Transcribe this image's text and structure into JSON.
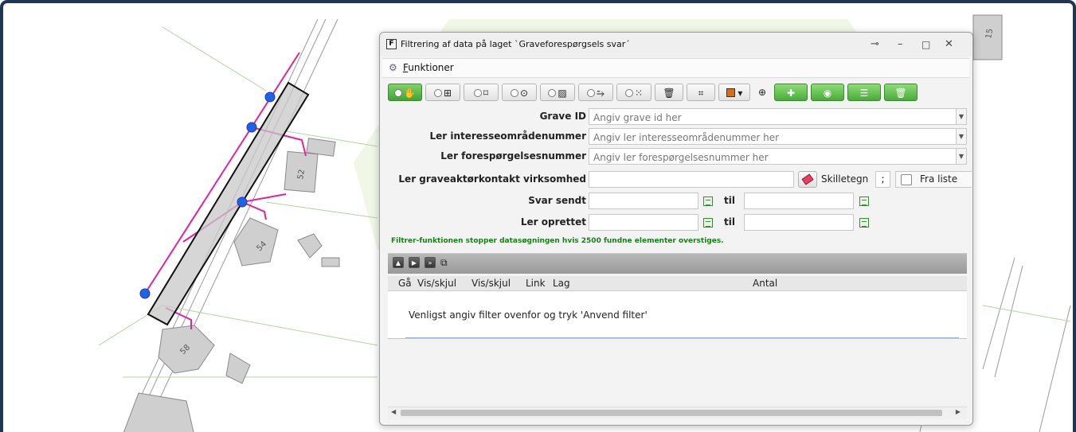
{
  "map": {
    "plot_labels": [
      "52",
      "54",
      "58",
      "15"
    ]
  },
  "dialog": {
    "title": "Filtrering af data på laget `Graveforespørgsels svar´",
    "title_icon": "F",
    "menu_label": "Funktioner",
    "menu_mnemonic": "F",
    "menu_rest": "unktioner",
    "window_buttons": {
      "pin": "⊸",
      "minimize": "–",
      "maximize": "□",
      "close": "✕"
    },
    "fields": {
      "grave_id": {
        "label": "Grave ID",
        "placeholder": "Angiv grave id her"
      },
      "interesse": {
        "label": "Ler interesseområdenummer",
        "placeholder": "Angiv ler interesseområdenummer her"
      },
      "foresp": {
        "label": "Ler forespørgelsesnummer",
        "placeholder": "Angiv ler forespørgelsesnummer her"
      },
      "kontakt": {
        "label": "Ler graveaktørkontakt virksomhed",
        "value": ""
      },
      "skilletegn": {
        "label": "Skilletegn",
        "value": ";"
      },
      "fraliste": {
        "label": "Fra liste"
      },
      "svar_sendt": {
        "label": "Svar sendt",
        "til": "til"
      },
      "oprettet": {
        "label": "Ler oprettet",
        "til": "til"
      }
    },
    "note": "Filtrer-funktionen stopper datasøgningen hvis 2500 fundne elementer overstiges.",
    "columns": [
      "Gå",
      "Vis/skjul",
      "Vis/skjul",
      "Link",
      "Lag",
      "Antal"
    ],
    "empty_message": "Venligst angiv filter ovenfor og tryk 'Anvend filter'",
    "colors": {
      "accent_green": "#3fa533",
      "note_green": "#1b7d1b",
      "frame_blue": "#1e3556"
    }
  }
}
